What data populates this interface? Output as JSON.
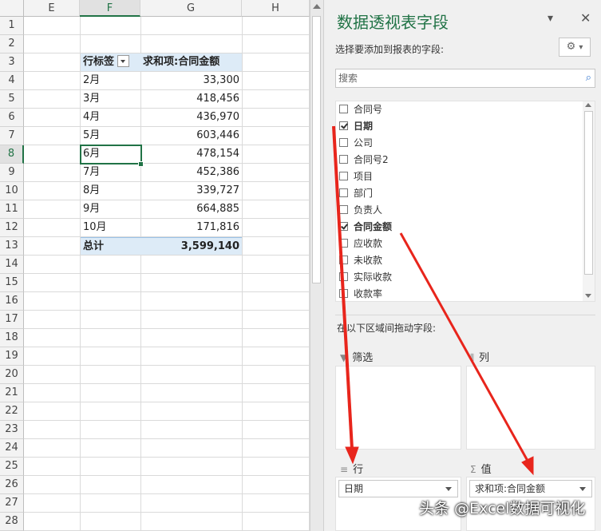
{
  "sheet": {
    "columns": [
      "E",
      "F",
      "G",
      "H"
    ],
    "rows": [
      "1",
      "2",
      "3",
      "4",
      "5",
      "6",
      "7",
      "8",
      "9",
      "10",
      "11",
      "12",
      "13",
      "14",
      "15",
      "16",
      "17",
      "18",
      "19",
      "20",
      "21",
      "22",
      "23",
      "24",
      "25",
      "26",
      "27",
      "28"
    ],
    "pivot": {
      "row_label_header": "行标签",
      "value_header": "求和项:合同金额",
      "rows": [
        {
          "label": "2月",
          "value": "33,300"
        },
        {
          "label": "3月",
          "value": "418,456"
        },
        {
          "label": "4月",
          "value": "436,970"
        },
        {
          "label": "5月",
          "value": "603,446"
        },
        {
          "label": "6月",
          "value": "478,154"
        },
        {
          "label": "7月",
          "value": "452,386"
        },
        {
          "label": "8月",
          "value": "339,727"
        },
        {
          "label": "9月",
          "value": "664,885"
        },
        {
          "label": "10月",
          "value": "171,816"
        }
      ],
      "total_label": "总计",
      "total_value": "3,599,140"
    },
    "selected_column": "F",
    "selected_row": "8"
  },
  "pane": {
    "title": "数据透视表字段",
    "subtitle": "选择要添加到报表的字段:",
    "search_placeholder": "搜索",
    "fields": [
      {
        "label": "合同号",
        "checked": false
      },
      {
        "label": "日期",
        "checked": true
      },
      {
        "label": "公司",
        "checked": false
      },
      {
        "label": "合同号2",
        "checked": false
      },
      {
        "label": "项目",
        "checked": false
      },
      {
        "label": "部门",
        "checked": false
      },
      {
        "label": "负责人",
        "checked": false
      },
      {
        "label": "合同金额",
        "checked": true
      },
      {
        "label": "应收款",
        "checked": false
      },
      {
        "label": "未收款",
        "checked": false
      },
      {
        "label": "实际收款",
        "checked": false
      },
      {
        "label": "收款率",
        "checked": false
      }
    ],
    "drag_hint": "在以下区域间拖动字段:",
    "areas": {
      "filter": "筛选",
      "columns": "列",
      "rows": "行",
      "values": "值"
    },
    "rows_field": "日期",
    "values_field": "求和项:合同金额"
  },
  "watermark": "头条 @Excel数据可视化",
  "colors": {
    "accent": "#217346",
    "pivot_fill": "#ddebf7",
    "annotation_arrow": "#e8251c"
  }
}
